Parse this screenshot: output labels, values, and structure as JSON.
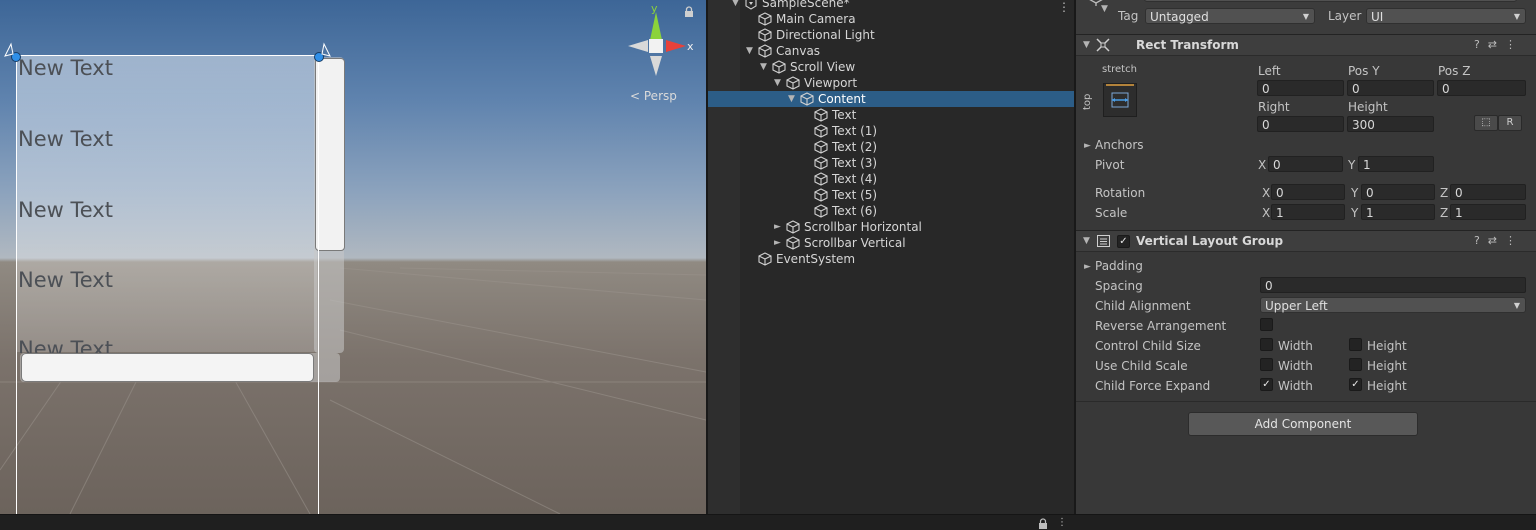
{
  "scene": {
    "texts": [
      "New Text",
      "New Text",
      "New Text",
      "New Text",
      "New Text"
    ],
    "persp_label": "Persp",
    "axis_x_label": "x",
    "axis_y_label": "y"
  },
  "hierarchy": {
    "items": [
      {
        "label": "SampleScene*",
        "depth": 0,
        "arrow": "▼",
        "selected": false
      },
      {
        "label": "Main Camera",
        "depth": 1,
        "arrow": "",
        "selected": false
      },
      {
        "label": "Directional Light",
        "depth": 1,
        "arrow": "",
        "selected": false
      },
      {
        "label": "Canvas",
        "depth": 1,
        "arrow": "▼",
        "selected": false
      },
      {
        "label": "Scroll View",
        "depth": 2,
        "arrow": "▼",
        "selected": false
      },
      {
        "label": "Viewport",
        "depth": 3,
        "arrow": "▼",
        "selected": false
      },
      {
        "label": "Content",
        "depth": 4,
        "arrow": "▼",
        "selected": true
      },
      {
        "label": "Text",
        "depth": 5,
        "arrow": "",
        "selected": false
      },
      {
        "label": "Text (1)",
        "depth": 5,
        "arrow": "",
        "selected": false
      },
      {
        "label": "Text (2)",
        "depth": 5,
        "arrow": "",
        "selected": false
      },
      {
        "label": "Text (3)",
        "depth": 5,
        "arrow": "",
        "selected": false
      },
      {
        "label": "Text (4)",
        "depth": 5,
        "arrow": "",
        "selected": false
      },
      {
        "label": "Text (5)",
        "depth": 5,
        "arrow": "",
        "selected": false
      },
      {
        "label": "Text (6)",
        "depth": 5,
        "arrow": "",
        "selected": false
      },
      {
        "label": "Scrollbar Horizontal",
        "depth": 3,
        "arrow": "►",
        "selected": false
      },
      {
        "label": "Scrollbar Vertical",
        "depth": 3,
        "arrow": "►",
        "selected": false
      },
      {
        "label": "EventSystem",
        "depth": 1,
        "arrow": "",
        "selected": false
      }
    ]
  },
  "inspector": {
    "tag_label": "Tag",
    "tag_value": "Untagged",
    "layer_label": "Layer",
    "layer_value": "UI",
    "rect_transform": {
      "title": "Rect Transform",
      "anchor_h": "stretch",
      "anchor_v": "top",
      "left_label": "Left",
      "left_value": "0",
      "posy_label": "Pos Y",
      "posy_value": "0",
      "posz_label": "Pos Z",
      "posz_value": "0",
      "right_label": "Right",
      "right_value": "0",
      "height_label": "Height",
      "height_value": "300",
      "raw_btn": "R",
      "anchors_label": "Anchors",
      "pivot_label": "Pivot",
      "pivot_x": "0",
      "pivot_y": "1",
      "rotation_label": "Rotation",
      "rot_x": "0",
      "rot_y": "0",
      "rot_z": "0",
      "scale_label": "Scale",
      "scale_x": "1",
      "scale_y": "1",
      "scale_z": "1",
      "x": "X",
      "y": "Y",
      "z": "Z"
    },
    "vlg": {
      "title": "Vertical Layout Group",
      "enabled": true,
      "padding_label": "Padding",
      "spacing_label": "Spacing",
      "spacing_value": "0",
      "child_alignment_label": "Child Alignment",
      "child_alignment_value": "Upper Left",
      "reverse_label": "Reverse Arrangement",
      "reverse_checked": false,
      "control_child_label": "Control Child Size",
      "use_child_scale_label": "Use Child Scale",
      "force_expand_label": "Child Force Expand",
      "width": "Width",
      "height": "Height",
      "control_w": false,
      "control_h": false,
      "scale_w": false,
      "scale_h": false,
      "expand_w": true,
      "expand_h": true
    },
    "add_component": "Add Component"
  },
  "colors": {
    "selection": "#2c5d87",
    "panel": "#383838",
    "hierarchy_bg": "#282828",
    "anchor_handle": "#2f8fe8"
  },
  "icons": [
    "cube-icon",
    "scene-icon",
    "help-icon",
    "preset-icon",
    "kebab-menu-icon",
    "lock-icon",
    "rect-transform-icon",
    "layout-group-icon",
    "gameobject-icon"
  ]
}
